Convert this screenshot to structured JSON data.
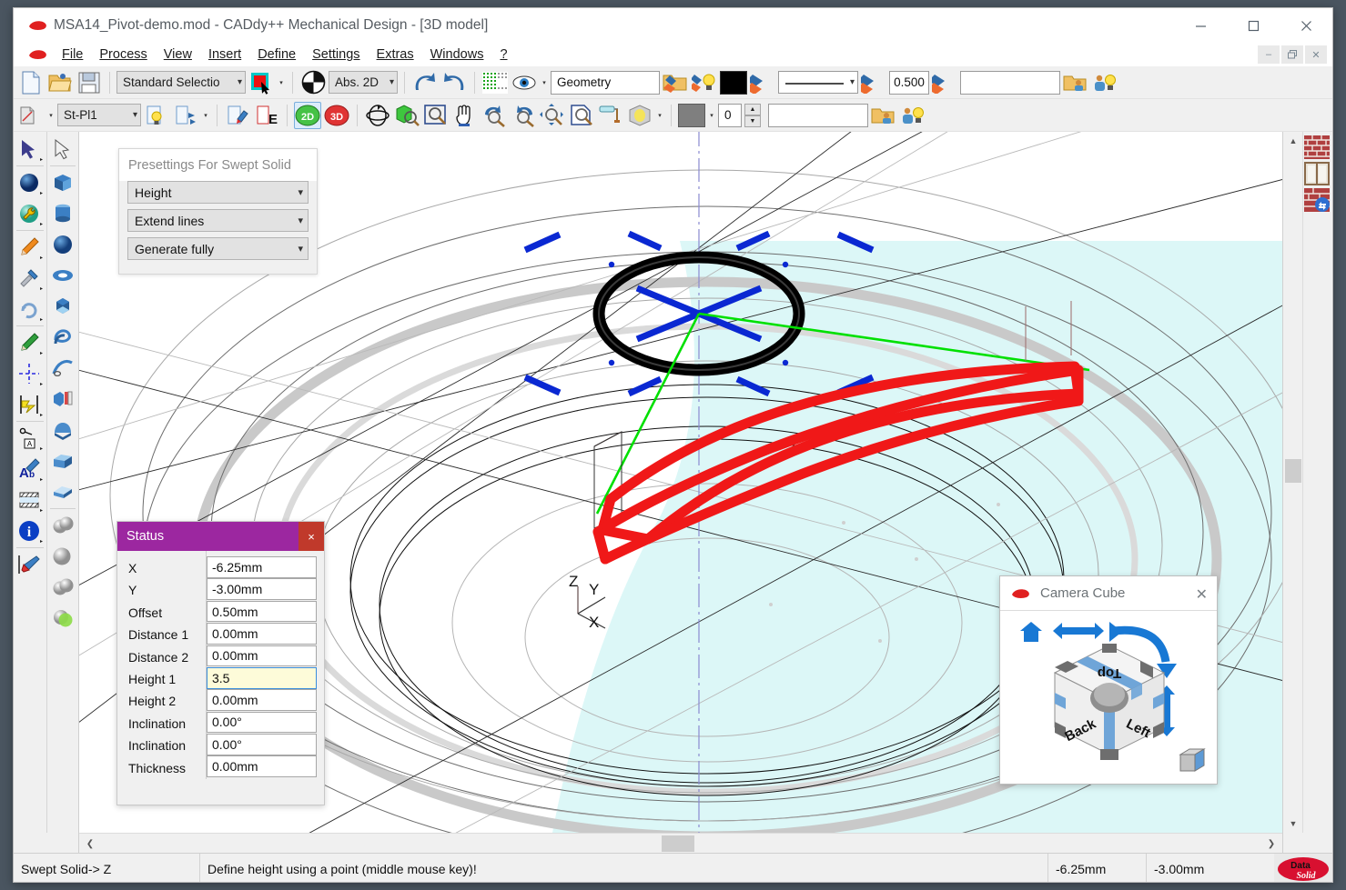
{
  "window": {
    "title": "MSA14_Pivot-demo.mod  -  CADdy++ Mechanical Design - [3D model]",
    "minimize": "—",
    "maximize": "☐",
    "close": "✕",
    "mdi_minimize": "–",
    "mdi_restore": "❐",
    "mdi_close": "✕"
  },
  "menubar": {
    "items": [
      {
        "label": "File",
        "accel": "F"
      },
      {
        "label": "Process",
        "accel": "P"
      },
      {
        "label": "View",
        "accel": "V"
      },
      {
        "label": "Insert",
        "accel": "I"
      },
      {
        "label": "Define",
        "accel": "D"
      },
      {
        "label": "Settings",
        "accel": "S"
      },
      {
        "label": "Extras",
        "accel": "x"
      },
      {
        "label": "Windows",
        "accel": "W"
      },
      {
        "label": "?",
        "accel": ""
      }
    ]
  },
  "toolbar1": {
    "new_label": "new-document",
    "open_label": "open-document",
    "save_label": "save-document",
    "selection_mode": "Standard Selectio",
    "color_picker": "red",
    "view_mode": "Abs. 2D",
    "undo": "undo",
    "redo": "redo",
    "grid": "grid-snap",
    "visibility": "eye-visibility",
    "layer_name": "Geometry",
    "line_width": "0.500",
    "extra_field": ""
  },
  "toolbar2": {
    "plane_name": "St-Pl1",
    "mode_2d": "2D",
    "mode_3d": "3D",
    "level_value": "0",
    "extra_field": ""
  },
  "presettings": {
    "title": "Presettings For Swept Solid",
    "options": [
      {
        "value": "Height"
      },
      {
        "value": "Extend lines"
      },
      {
        "value": "Generate fully"
      }
    ]
  },
  "status_dialog": {
    "title": "Status",
    "close": "×",
    "rows": [
      {
        "label": "X",
        "value": "-6.25mm",
        "focused": false
      },
      {
        "label": "Y",
        "value": "-3.00mm",
        "focused": false
      },
      {
        "label": "Offset",
        "value": "0.50mm",
        "focused": false
      },
      {
        "label": "Distance 1",
        "value": "0.00mm",
        "focused": false
      },
      {
        "label": "Distance 2",
        "value": "0.00mm",
        "focused": false
      },
      {
        "label": "Height 1",
        "value": "3.5",
        "focused": true
      },
      {
        "label": "Height 2",
        "value": "0.00mm",
        "focused": false
      },
      {
        "label": "Inclination",
        "value": "0.00°",
        "focused": false
      },
      {
        "label": "Inclination",
        "value": "0.00°",
        "focused": false
      },
      {
        "label": "Thickness",
        "value": "0.00mm",
        "focused": false
      }
    ]
  },
  "camera_cube": {
    "title": "Camera Cube",
    "close": "✕",
    "faces": {
      "top": "Top",
      "back": "Back",
      "left": "Left"
    }
  },
  "viewport": {
    "axis_labels": {
      "z": "Z",
      "y": "Y",
      "x": "X"
    },
    "colors": {
      "selection_red": "#f01818",
      "guide_green": "#00e000",
      "marker_blue": "#0a28d2",
      "plane_fill": "#dcf7f7",
      "ring_black": "#000000",
      "shadow_gray": "#c8c8c8"
    }
  },
  "statusbar": {
    "mode": "Swept Solid-> Z",
    "message": "Define height using a point (middle mouse key)!",
    "coord_x": "-6.25mm",
    "coord_y": "-3.00mm",
    "brand_top": "Data",
    "brand_bottom": "Solid"
  }
}
